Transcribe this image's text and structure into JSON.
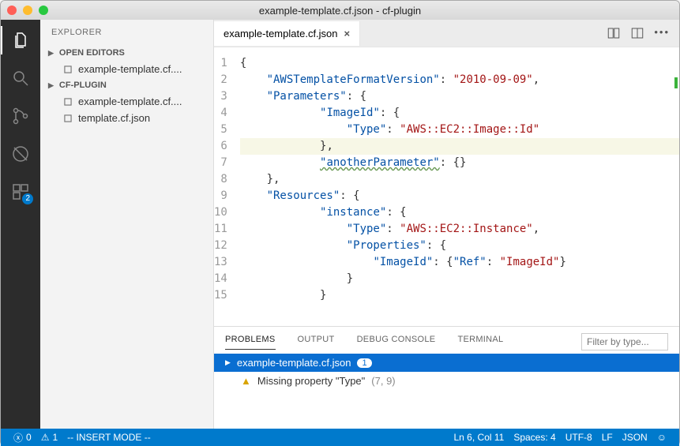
{
  "window": {
    "title": "example-template.cf.json - cf-plugin"
  },
  "activitybar": {
    "icons": [
      "files",
      "search",
      "git",
      "debug",
      "extensions"
    ],
    "active": "files",
    "extensions_badge": "2"
  },
  "sidebar": {
    "title": "EXPLORER",
    "sections": [
      {
        "label": "OPEN EDITORS",
        "items": [
          {
            "label": "example-template.cf...."
          }
        ]
      },
      {
        "label": "CF-PLUGIN",
        "items": [
          {
            "label": "example-template.cf...."
          },
          {
            "label": "template.cf.json"
          }
        ]
      }
    ]
  },
  "editor": {
    "tab": {
      "label": "example-template.cf.json"
    },
    "lines": [
      {
        "n": "1",
        "indent": 0,
        "tokens": [
          [
            "punc",
            "{"
          ]
        ]
      },
      {
        "n": "2",
        "indent": 1,
        "tokens": [
          [
            "key",
            "\"AWSTemplateFormatVersion\""
          ],
          [
            "punc",
            ": "
          ],
          [
            "str",
            "\"2010-09-09\""
          ],
          [
            "punc",
            ","
          ]
        ]
      },
      {
        "n": "3",
        "indent": 1,
        "tokens": [
          [
            "key",
            "\"Parameters\""
          ],
          [
            "punc",
            ": {"
          ]
        ]
      },
      {
        "n": "4",
        "indent": 3,
        "tokens": [
          [
            "key",
            "\"ImageId\""
          ],
          [
            "punc",
            ": {"
          ]
        ]
      },
      {
        "n": "5",
        "indent": 4,
        "tokens": [
          [
            "key",
            "\"Type\""
          ],
          [
            "punc",
            ": "
          ],
          [
            "str",
            "\"AWS::EC2::Image::Id\""
          ]
        ]
      },
      {
        "n": "6",
        "indent": 3,
        "tokens": [
          [
            "punc",
            "},"
          ]
        ],
        "current": true
      },
      {
        "n": "7",
        "indent": 3,
        "tokens": [
          [
            "keywarn",
            "\"anotherParameter\""
          ],
          [
            "punc",
            ": {}"
          ]
        ]
      },
      {
        "n": "8",
        "indent": 1,
        "tokens": [
          [
            "punc",
            "},"
          ]
        ]
      },
      {
        "n": "9",
        "indent": 1,
        "tokens": [
          [
            "key",
            "\"Resources\""
          ],
          [
            "punc",
            ": {"
          ]
        ]
      },
      {
        "n": "10",
        "indent": 3,
        "tokens": [
          [
            "key",
            "\"instance\""
          ],
          [
            "punc",
            ": {"
          ]
        ]
      },
      {
        "n": "11",
        "indent": 4,
        "tokens": [
          [
            "key",
            "\"Type\""
          ],
          [
            "punc",
            ": "
          ],
          [
            "str",
            "\"AWS::EC2::Instance\""
          ],
          [
            "punc",
            ","
          ]
        ]
      },
      {
        "n": "12",
        "indent": 4,
        "tokens": [
          [
            "key",
            "\"Properties\""
          ],
          [
            "punc",
            ": {"
          ]
        ]
      },
      {
        "n": "13",
        "indent": 5,
        "tokens": [
          [
            "key",
            "\"ImageId\""
          ],
          [
            "punc",
            ": {"
          ],
          [
            "key",
            "\"Ref\""
          ],
          [
            "punc",
            ": "
          ],
          [
            "str",
            "\"ImageId\""
          ],
          [
            "punc",
            "}"
          ]
        ]
      },
      {
        "n": "14",
        "indent": 4,
        "tokens": [
          [
            "punc",
            "}"
          ]
        ]
      },
      {
        "n": "15",
        "indent": 3,
        "tokens": [
          [
            "punc",
            "}"
          ]
        ]
      }
    ]
  },
  "panel": {
    "tabs": {
      "problems": "PROBLEMS",
      "output": "OUTPUT",
      "debug": "DEBUG CONSOLE",
      "terminal": "TERMINAL"
    },
    "filter_placeholder": "Filter by type...",
    "file": {
      "name": "example-template.cf.json",
      "count": "1"
    },
    "items": [
      {
        "msg": "Missing property \"Type\"",
        "loc": "(7, 9)"
      }
    ]
  },
  "statusbar": {
    "errors": "0",
    "warnings": "1",
    "mode": "-- INSERT MODE --",
    "cursor": "Ln 6, Col 11",
    "spaces": "Spaces: 4",
    "encoding": "UTF-8",
    "eol": "LF",
    "lang": "JSON"
  }
}
